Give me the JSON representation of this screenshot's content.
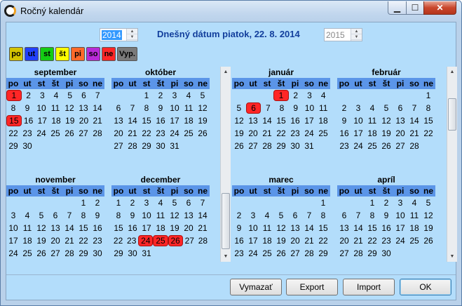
{
  "window": {
    "title": "Ročný kalendár",
    "minimize": "▁",
    "maximize": "☐",
    "close": "✕"
  },
  "year_left": "2014",
  "year_right": "2015",
  "today_label": "Dnešný dátum piatok, 22. 8. 2014",
  "legend": [
    {
      "label": "po",
      "color": "#d4c400"
    },
    {
      "label": "ut",
      "color": "#2140ff"
    },
    {
      "label": "st",
      "color": "#14cc14"
    },
    {
      "label": "št",
      "color": "#ffff00"
    },
    {
      "label": "pi",
      "color": "#ff6a2a"
    },
    {
      "label": "so",
      "color": "#b82ad8"
    },
    {
      "label": "ne",
      "color": "#ff2626"
    },
    {
      "label": "Vyp.",
      "color": "#7a7a7a"
    }
  ],
  "dow": [
    "po",
    "ut",
    "st",
    "št",
    "pi",
    "so",
    "ne"
  ],
  "months_left": [
    {
      "name": "september",
      "weeks": [
        [
          "1",
          "2",
          "3",
          "4",
          "5",
          "6",
          "7"
        ],
        [
          "8",
          "9",
          "10",
          "11",
          "12",
          "13",
          "14"
        ],
        [
          "15",
          "16",
          "17",
          "18",
          "19",
          "20",
          "21"
        ],
        [
          "22",
          "23",
          "24",
          "25",
          "26",
          "27",
          "28"
        ],
        [
          "29",
          "30",
          "",
          "",
          "",
          "",
          ""
        ]
      ],
      "highlight": [
        "1",
        "15"
      ]
    },
    {
      "name": "október",
      "weeks": [
        [
          "",
          "",
          "1",
          "2",
          "3",
          "4",
          "5"
        ],
        [
          "6",
          "7",
          "8",
          "9",
          "10",
          "11",
          "12"
        ],
        [
          "13",
          "14",
          "15",
          "16",
          "17",
          "18",
          "19"
        ],
        [
          "20",
          "21",
          "22",
          "23",
          "24",
          "25",
          "26"
        ],
        [
          "27",
          "28",
          "29",
          "30",
          "31",
          "",
          ""
        ]
      ],
      "highlight": []
    },
    {
      "name": "november",
      "weeks": [
        [
          "",
          "",
          "",
          "",
          "",
          "1",
          "2"
        ],
        [
          "3",
          "4",
          "5",
          "6",
          "7",
          "8",
          "9"
        ],
        [
          "10",
          "11",
          "12",
          "13",
          "14",
          "15",
          "16"
        ],
        [
          "17",
          "18",
          "19",
          "20",
          "21",
          "22",
          "23"
        ],
        [
          "24",
          "25",
          "26",
          "27",
          "28",
          "29",
          "30"
        ]
      ],
      "highlight": []
    },
    {
      "name": "december",
      "weeks": [
        [
          "1",
          "2",
          "3",
          "4",
          "5",
          "6",
          "7"
        ],
        [
          "8",
          "9",
          "10",
          "11",
          "12",
          "13",
          "14"
        ],
        [
          "15",
          "16",
          "17",
          "18",
          "19",
          "20",
          "21"
        ],
        [
          "22",
          "23",
          "24",
          "25",
          "26",
          "27",
          "28"
        ],
        [
          "29",
          "30",
          "31",
          "",
          "",
          "",
          ""
        ]
      ],
      "highlight": [
        "24",
        "25",
        "26"
      ]
    }
  ],
  "months_right": [
    {
      "name": "január",
      "weeks": [
        [
          "",
          "",
          "",
          "1",
          "2",
          "3",
          "4"
        ],
        [
          "5",
          "6",
          "7",
          "8",
          "9",
          "10",
          "11"
        ],
        [
          "12",
          "13",
          "14",
          "15",
          "16",
          "17",
          "18"
        ],
        [
          "19",
          "20",
          "21",
          "22",
          "23",
          "24",
          "25"
        ],
        [
          "26",
          "27",
          "28",
          "29",
          "30",
          "31",
          ""
        ]
      ],
      "highlight": [
        "1",
        "6"
      ]
    },
    {
      "name": "február",
      "weeks": [
        [
          "",
          "",
          "",
          "",
          "",
          "",
          "1"
        ],
        [
          "2",
          "3",
          "4",
          "5",
          "6",
          "7",
          "8"
        ],
        [
          "9",
          "10",
          "11",
          "12",
          "13",
          "14",
          "15"
        ],
        [
          "16",
          "17",
          "18",
          "19",
          "20",
          "21",
          "22"
        ],
        [
          "23",
          "24",
          "25",
          "26",
          "27",
          "28",
          ""
        ]
      ],
      "highlight": []
    },
    {
      "name": "marec",
      "weeks": [
        [
          "",
          "",
          "",
          "",
          "",
          "",
          "1"
        ],
        [
          "2",
          "3",
          "4",
          "5",
          "6",
          "7",
          "8"
        ],
        [
          "9",
          "10",
          "11",
          "12",
          "13",
          "14",
          "15"
        ],
        [
          "16",
          "17",
          "18",
          "19",
          "20",
          "21",
          "22"
        ],
        [
          "23",
          "24",
          "25",
          "26",
          "27",
          "28",
          "29"
        ]
      ],
      "highlight": []
    },
    {
      "name": "apríl",
      "weeks": [
        [
          "",
          "",
          "1",
          "2",
          "3",
          "4",
          "5"
        ],
        [
          "6",
          "7",
          "8",
          "9",
          "10",
          "11",
          "12"
        ],
        [
          "13",
          "14",
          "15",
          "16",
          "17",
          "18",
          "19"
        ],
        [
          "20",
          "21",
          "22",
          "23",
          "24",
          "25",
          "26"
        ],
        [
          "27",
          "28",
          "29",
          "30",
          "",
          "",
          ""
        ]
      ],
      "highlight": []
    }
  ],
  "buttons": {
    "clear": "Vymazať",
    "export": "Export",
    "import": "Import",
    "ok": "OK"
  },
  "scroll_arrows": {
    "up": "▲",
    "down": "▼"
  },
  "spin_arrows": {
    "up": "▲",
    "down": "▼"
  }
}
